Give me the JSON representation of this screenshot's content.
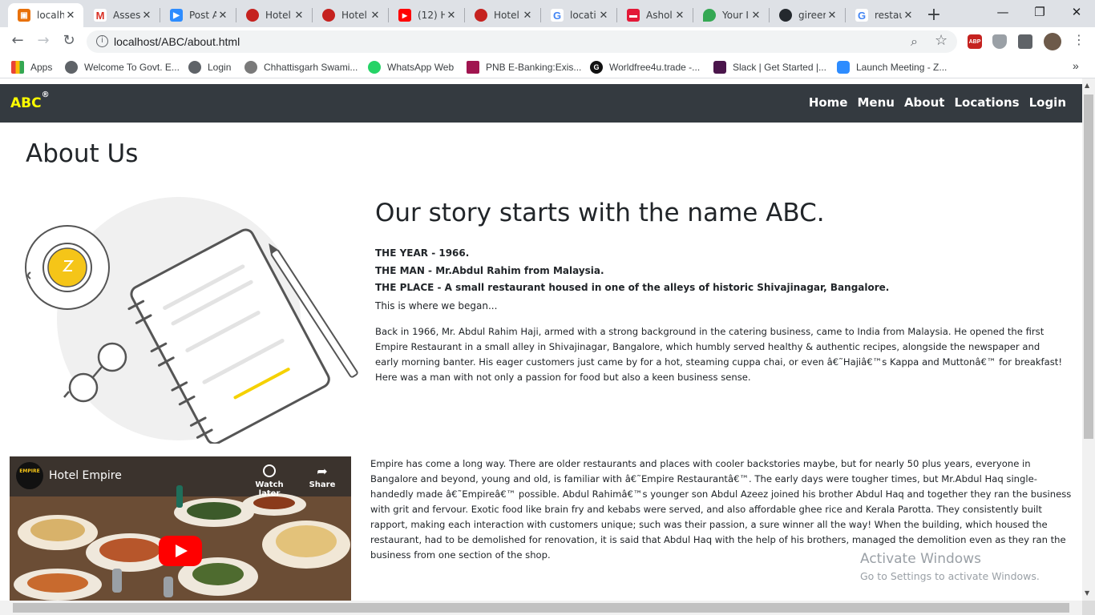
{
  "browser": {
    "tabs": [
      {
        "title": "localh",
        "color": "#e8710a",
        "glyph": "▣",
        "active": true
      },
      {
        "title": "Asses",
        "color": "#d93025",
        "glyph": "M"
      },
      {
        "title": "Post A",
        "color": "#2d8cff",
        "glyph": "▶"
      },
      {
        "title": "Hotel",
        "color": "#c5221f",
        "glyph": "●"
      },
      {
        "title": "Hotel",
        "color": "#c5221f",
        "glyph": "●"
      },
      {
        "title": "(12) H",
        "color": "#ff0000",
        "glyph": "▶"
      },
      {
        "title": "Hotel",
        "color": "#c5221f",
        "glyph": "●"
      },
      {
        "title": "locati",
        "color": "#4285f4",
        "glyph": "G"
      },
      {
        "title": "Ashol",
        "color": "#e31837",
        "glyph": "▬"
      },
      {
        "title": "Your I",
        "color": "#34a853",
        "glyph": "◆"
      },
      {
        "title": "gireer",
        "color": "#24292e",
        "glyph": "●"
      },
      {
        "title": "restau",
        "color": "#4285f4",
        "glyph": "G"
      }
    ],
    "new_tab": "+",
    "window_controls": {
      "minimize": "—",
      "maximize": "❐",
      "close": "✕"
    },
    "url": "localhost/ABC/about.html",
    "nav": {
      "back": "←",
      "forward": "→",
      "reload": "↻"
    },
    "omni_icons": {
      "zoom": "⌕",
      "star": "☆"
    },
    "extensions": {
      "abp": "ABP"
    },
    "bookmarks": [
      {
        "label": "Apps",
        "color": "#4285f4",
        "icon": "apps-icon"
      },
      {
        "label": "Welcome To Govt. E...",
        "color": "#5f6368",
        "icon": "globe-icon"
      },
      {
        "label": "Login",
        "color": "#5f6368",
        "icon": "globe-icon"
      },
      {
        "label": "Chhattisgarh Swami...",
        "color": "#7a7a7a",
        "icon": "seal-icon"
      },
      {
        "label": "WhatsApp Web",
        "color": "#25d366",
        "icon": "whatsapp-icon"
      },
      {
        "label": "PNB E-Banking:Exis...",
        "color": "#a0144f",
        "icon": "pnb-icon"
      },
      {
        "label": "Worldfree4u.trade -...",
        "color": "#111111",
        "icon": "g-icon"
      },
      {
        "label": "Slack | Get Started |...",
        "color": "#4a154b",
        "icon": "slack-icon"
      },
      {
        "label": "Launch Meeting - Z...",
        "color": "#2d8cff",
        "icon": "zoom-icon"
      }
    ],
    "bookmarks_more": "»"
  },
  "site": {
    "brand": "ABC",
    "brand_mark": "®",
    "nav": [
      "Home",
      "Menu",
      "About",
      "Locations",
      "Login"
    ]
  },
  "about": {
    "title": "About Us",
    "story_heading": "Our story starts with the name ABC.",
    "facts": [
      "THE YEAR - 1966.",
      "THE MAN - Mr.Abdul Rahim from Malaysia.",
      "THE PLACE - A small restaurant housed in one of the alleys of historic Shivajinagar, Bangalore."
    ],
    "began": "This is where we began...",
    "paragraph1": "Back in 1966, Mr. Abdul Rahim Haji, armed with a strong background in the catering business, came to India from Malaysia. He opened the first Empire Restaurant in a small alley in Shivajinagar, Bangalore, which humbly served healthy & authentic recipes, alongside the newspaper and early morning banter. His eager customers just came by for a hot, steaming cuppa chai, or even â€˜Hajiâ€™s Kappa and Muttonâ€™ for breakfast! Here was a man with not only a passion for food but also a keen business sense.",
    "paragraph2": "Empire has come a long way. There are older restaurants and places with cooler backstories maybe, but for nearly 50 plus years, everyone in Bangalore and beyond, young and old, is familiar with â€˜Empire Restaurantâ€™. The early days were tougher times, but Mr.Abdul Haq single-handedly made â€˜Empireâ€™ possible. Abdul Rahimâ€™s younger son Abdul Azeez joined his brother Abdul Haq and together they ran the business with grit and fervour. Exotic food like brain fry and kebabs were served, and also affordable ghee rice and Kerala Parotta. They consistently built rapport, making each interaction with customers unique; such was their passion, a sure winner all the way! When the building, which housed the restaurant, had to be demolished for renovation, it is said that Abdul Haq with the help of his brothers, managed the demolition even as they ran the business from one section of the shop."
  },
  "video": {
    "title": "Hotel Empire",
    "channel_logo": "EMPIRE",
    "watch_later": "Watch later",
    "share": "Share"
  },
  "watermark": {
    "line1": "Activate Windows",
    "line2": "Go to Settings to activate Windows."
  }
}
